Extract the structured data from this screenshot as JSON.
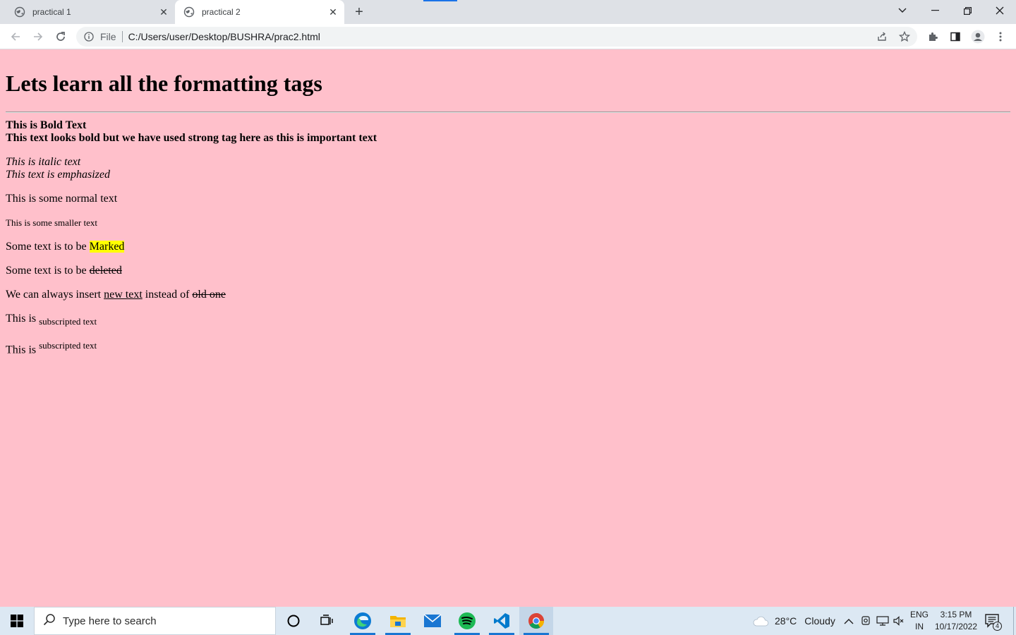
{
  "browser": {
    "tabs": [
      {
        "title": "practical 1",
        "active": false
      },
      {
        "title": "practical 2",
        "active": true
      }
    ],
    "address": {
      "scheme_label": "File",
      "url": "C:/Users/user/Desktop/BUSHRA/prac2.html"
    }
  },
  "page": {
    "background": "#ffc0cb",
    "heading": "Lets learn all the formatting tags",
    "bold_text": "This is Bold Text",
    "strong_text": "This text looks bold but we have used strong tag here as this is important text",
    "italic_text": "This is italic text",
    "emphasized_text": "This text is emphasized",
    "normal_text": "This is some normal text",
    "small_text": "This is some smaller text",
    "mark_prefix": "Some text is to be ",
    "mark_word": "Marked",
    "del_prefix": "Some text is to be ",
    "del_word": "deleted",
    "ins_prefix": "We can always insert ",
    "ins_word": "new text",
    "ins_middle": " instead of ",
    "ins_del_word": "old one",
    "sub_prefix": "This is ",
    "sub_text": "subscripted text",
    "sup_prefix": "This is ",
    "sup_text": "subscripted text"
  },
  "taskbar": {
    "search_placeholder": "Type here to search",
    "apps": [
      "cortana-icon",
      "task-view-icon",
      "edge-icon",
      "file-explorer-icon",
      "mail-icon",
      "spotify-icon",
      "vscode-icon",
      "chrome-icon"
    ],
    "weather": {
      "temp": "28°C",
      "condition": "Cloudy"
    },
    "lang": {
      "line1": "ENG",
      "line2": "IN"
    },
    "clock": {
      "time": "3:15 PM",
      "date": "10/17/2022"
    },
    "notification_count": "4"
  }
}
